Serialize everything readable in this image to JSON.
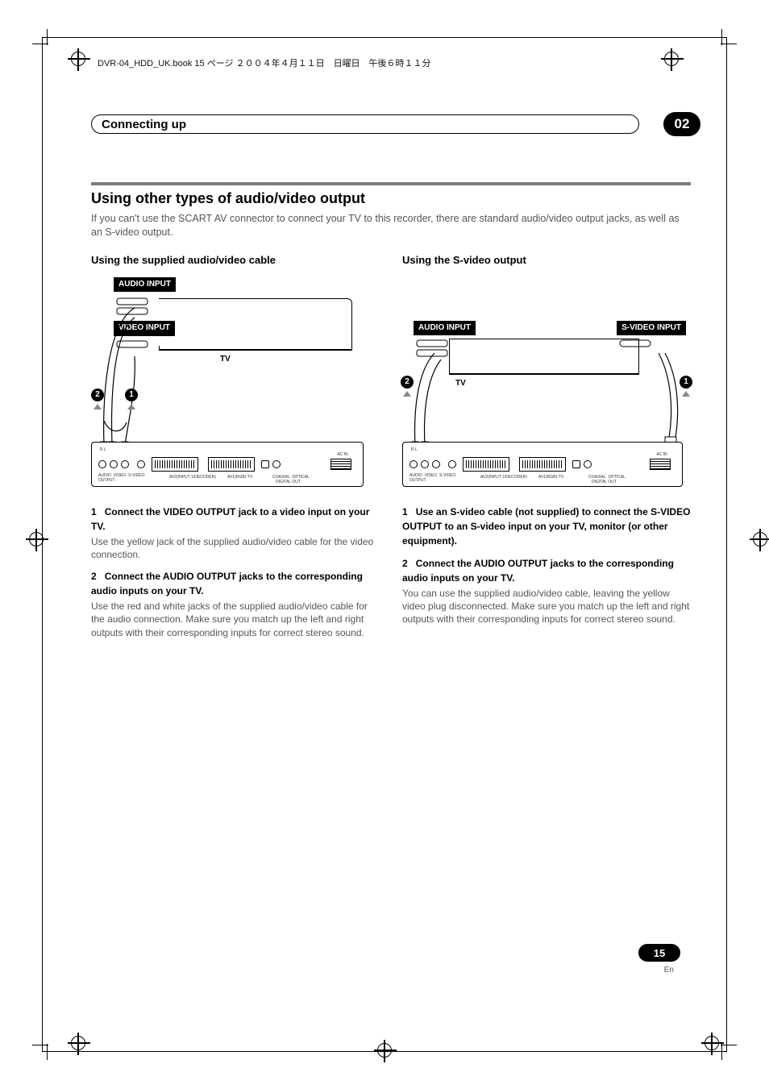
{
  "header_line": "DVR-04_HDD_UK.book  15 ページ  ２００４年４月１１日　日曜日　午後６時１１分",
  "chapter": {
    "title": "Connecting up",
    "number": "02"
  },
  "section": {
    "rule": true,
    "h2": "Using other types of audio/video output",
    "intro": "If you can't use the SCART AV connector to connect your TV to this recorder, there are standard audio/video output jacks, as well as an S-video output."
  },
  "left": {
    "h3": "Using the supplied audio/video cable",
    "labels": {
      "audio": "AUDIO INPUT",
      "video": "VIDEO INPUT",
      "tv": "TV"
    },
    "steps": [
      {
        "num": "1",
        "title": "Connect the VIDEO OUTPUT jack to a video input on your TV.",
        "body": "Use the yellow jack of the supplied audio/video cable for the video connection."
      },
      {
        "num": "2",
        "title": "Connect the AUDIO OUTPUT jacks to the corresponding audio inputs on your TV.",
        "body": "Use the red and white jacks of the supplied audio/video cable for the audio connection. Make sure you match up the left and right outputs with their corresponding inputs for correct stereo sound."
      }
    ]
  },
  "right": {
    "h3": "Using the S-video output",
    "labels": {
      "audio": "AUDIO INPUT",
      "svideo": "S-VIDEO INPUT",
      "tv": "TV"
    },
    "steps": [
      {
        "num": "1",
        "title": "Use an S-video cable (not supplied) to connect the S-VIDEO OUTPUT to an S-video input on your TV, monitor (or other equipment).",
        "body": ""
      },
      {
        "num": "2",
        "title": "Connect the AUDIO OUTPUT jacks to the corresponding audio inputs on your TV.",
        "body": "You can use the supplied audio/video cable, leaving the yellow video plug disconnected. Make sure you match up the left and right outputs with their corresponding inputs for correct stereo sound."
      }
    ]
  },
  "rear_labels": {
    "acin": "AC IN",
    "av2": "AV2(INPUT 1/DECODER)",
    "av1": "AV1(RGB)-TV",
    "coax": "COAXIAL",
    "opt": "OPTICAL",
    "digout": "DIGITAL OUT",
    "svo": "S-VIDEO",
    "out": "OUTPUT",
    "audio": "AUDIO",
    "video": "VIDEO",
    "rl": "R   L"
  },
  "page": {
    "num": "15",
    "lang": "En"
  }
}
